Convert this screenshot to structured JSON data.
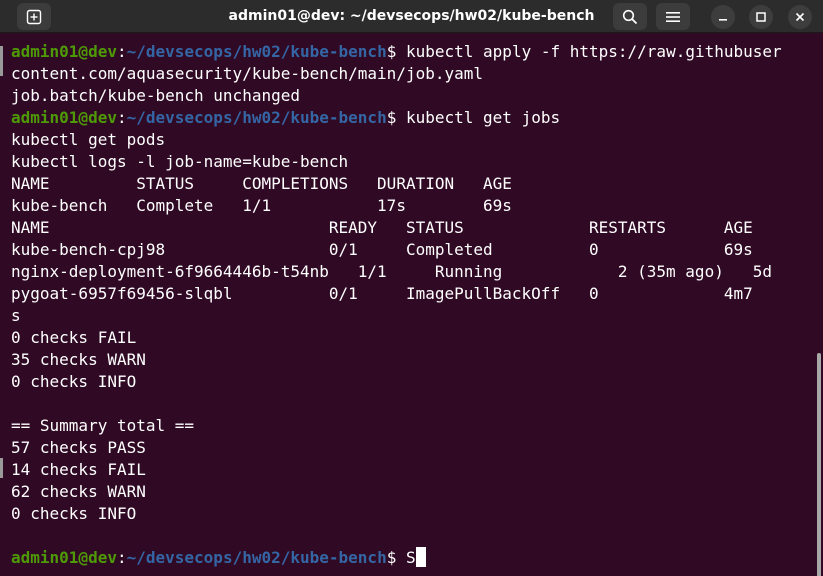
{
  "window": {
    "title": "admin01@dev: ~/devsecops/hw02/kube-bench"
  },
  "icons": {
    "new_tab": "new-tab-icon",
    "search": "search-icon",
    "menu": "hamburger-menu-icon",
    "minimize": "minimize-icon",
    "maximize": "maximize-icon",
    "close": "close-icon"
  },
  "colors": {
    "background": "#300a24",
    "prompt_user": "#4e9a06",
    "prompt_path": "#3465a4",
    "text": "#ffffff"
  },
  "prompt": {
    "user": "admin01@dev",
    "sep": ":",
    "path": "~/devsecops/hw02/kube-bench",
    "symbol": "$"
  },
  "terminal": {
    "cmd1": " kubectl apply -f https://raw.githubuser",
    "cmd1_wrap": "content.com/aquasecurity/kube-bench/main/job.yaml",
    "out1": "job.batch/kube-bench unchanged",
    "cmd2": " kubectl get jobs",
    "cmd2_line2": "kubectl get pods",
    "cmd2_line3": "kubectl logs -l job-name=kube-bench",
    "jobs_header": "NAME         STATUS     COMPLETIONS   DURATION   AGE",
    "jobs_row": "kube-bench   Complete   1/1           17s        69s",
    "pods_header": "NAME                             READY   STATUS             RESTARTS      AGE",
    "pods_row1": "kube-bench-cpj98                 0/1     Completed          0             69s",
    "pods_row2": "nginx-deployment-6f9664446b-t54nb   1/1     Running            2 (35m ago)   5d",
    "pods_row3": "pygoat-6957f69456-slqbl          0/1     ImagePullBackOff   0             4m7",
    "pods_row3_wrap": "s",
    "log1": "0 checks FAIL",
    "log2": "35 checks WARN",
    "log3": "0 checks INFO",
    "summary_title": "== Summary total ==",
    "sum1": "57 checks PASS",
    "sum2": "14 checks FAIL",
    "sum3": "62 checks WARN",
    "sum4": "0 checks INFO",
    "last_input": " S"
  }
}
